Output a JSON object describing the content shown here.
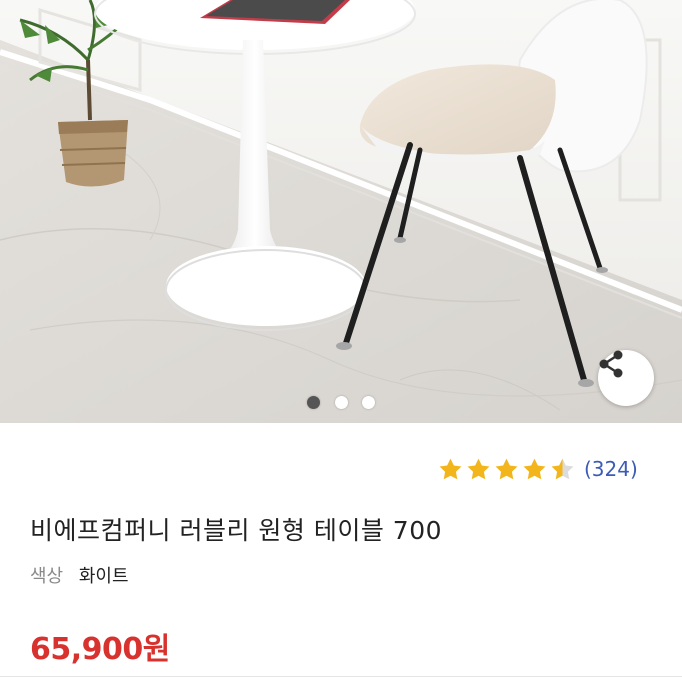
{
  "gallery": {
    "image_alt": "white round table with chair",
    "page_count": 3,
    "current_index": 0,
    "share_icon": "share-icon"
  },
  "rating": {
    "stars": 4.5,
    "max_stars": 5,
    "review_count_text": "(324)",
    "star_color": "#f2b51c"
  },
  "product": {
    "title": "비에프컴퍼니 러블리 원형 테이블 700",
    "option_label": "색상",
    "option_value": "화이트",
    "price": "65,900원",
    "price_color": "#d8322f"
  }
}
